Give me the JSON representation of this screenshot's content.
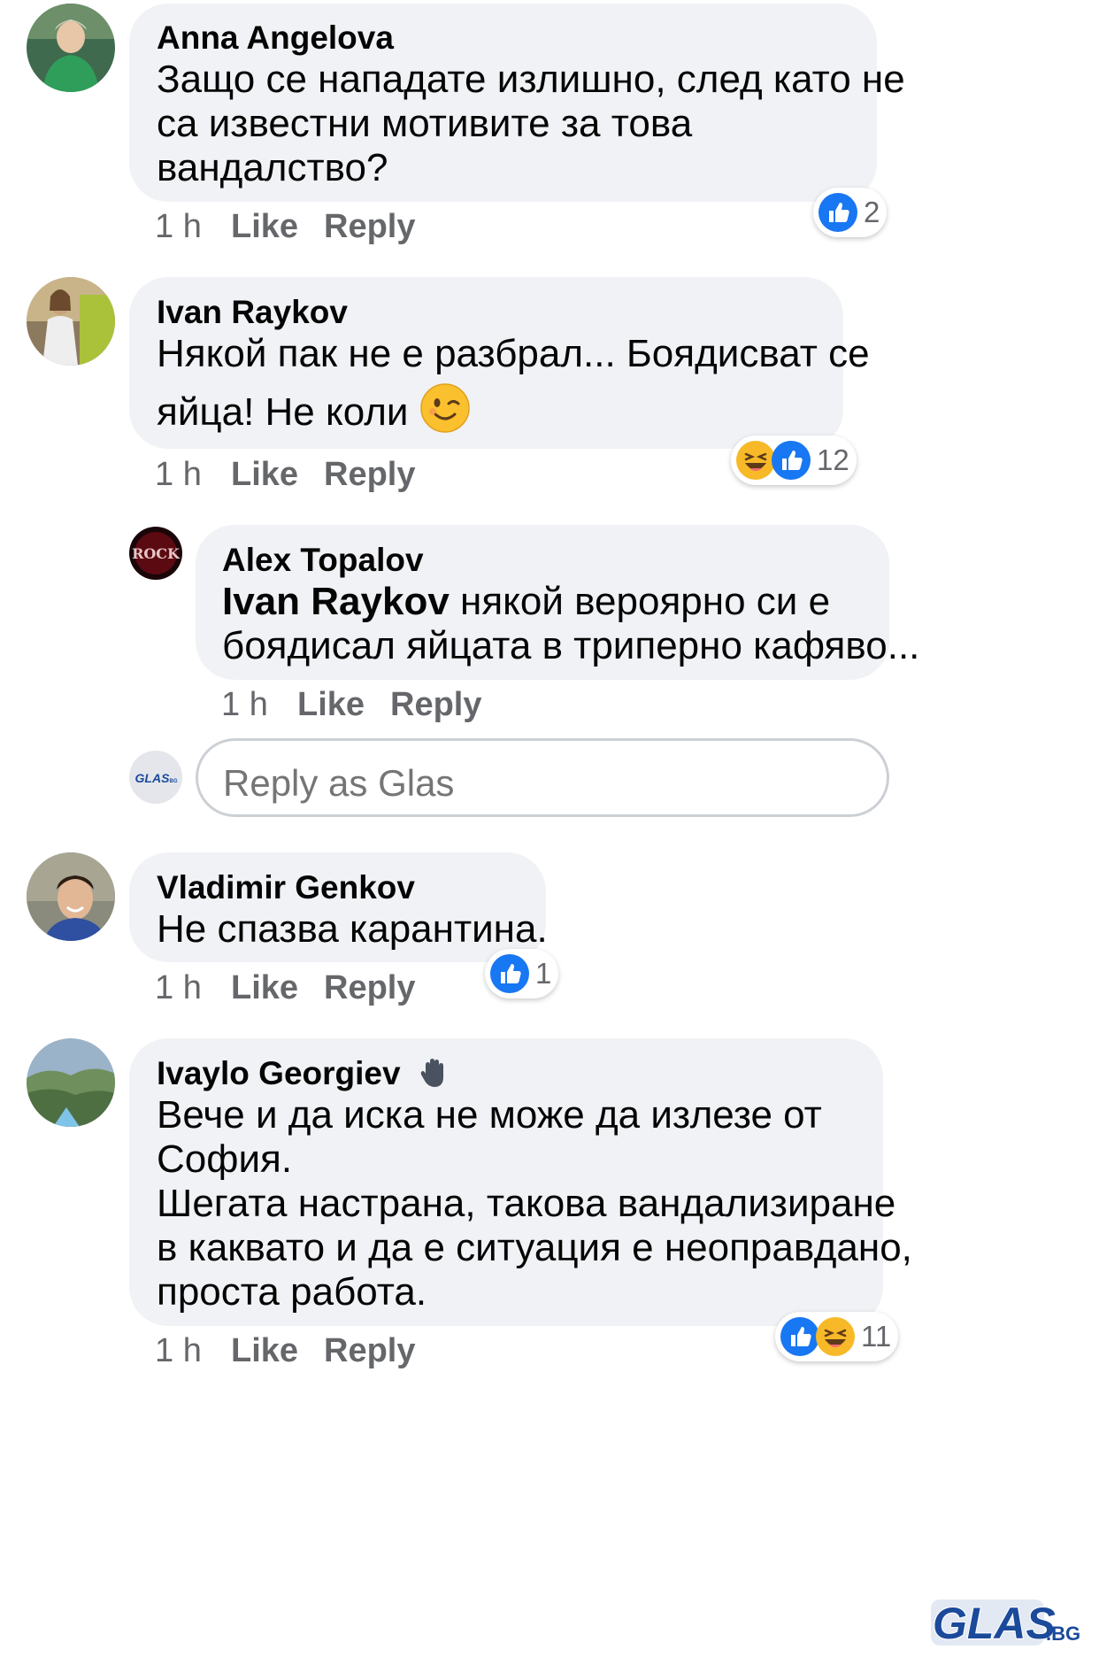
{
  "comments": [
    {
      "author": "Anna Angelova",
      "lines": [
        "Защо се нападате излишно, след като не",
        "са известни мотивите за това",
        "вандалство?"
      ],
      "time": "1 h",
      "like_label": "Like",
      "reply_label": "Reply",
      "reaction_count": "2",
      "reaction_icons": [
        "like-icon"
      ]
    },
    {
      "author": "Ivan Raykov",
      "lines": [
        "Някой пак не е разбрал... Боядисват се",
        "яйца! Не коли"
      ],
      "emoji": "winking-face-emoji",
      "time": "1 h",
      "like_label": "Like",
      "reply_label": "Reply",
      "reaction_count": "12",
      "reaction_icons": [
        "haha-icon",
        "like-icon"
      ]
    },
    {
      "author": "Alex Topalov",
      "mention": "Ivan Raykov",
      "lines": [
        " някой вероярно си е",
        "боядисал яйцата в триперно кафяво..."
      ],
      "time": "1 h",
      "like_label": "Like",
      "reply_label": "Reply"
    },
    {
      "author": "Vladimir Genkov",
      "lines": [
        "Не спазва карантина."
      ],
      "time": "1 h",
      "like_label": "Like",
      "reply_label": "Reply",
      "reaction_count": "1",
      "reaction_icons": [
        "like-icon"
      ]
    },
    {
      "author": "Ivaylo Georgiev",
      "author_icon": "waving-hand-icon",
      "lines": [
        "Вече и да иска не може да излезе от",
        "София.",
        "Шегата настрана, такова вандализиране",
        "в каквато и да е ситуация е неоправдано,",
        "проста работа."
      ],
      "time": "1 h",
      "like_label": "Like",
      "reply_label": "Reply",
      "reaction_count": "11",
      "reaction_icons": [
        "like-icon",
        "haha-icon"
      ]
    }
  ],
  "reply_box": {
    "placeholder": "Reply as Glas",
    "avatar_logo_text": "GLAS",
    "avatar_logo_suffix": "BG"
  },
  "watermark": {
    "text": "GLAS",
    "suffix": ".BG"
  },
  "colors": {
    "bubble": "#f0f2f5",
    "meta_text": "#65676b",
    "like_blue": "#1877f2",
    "haha_yellow": "#f7b928",
    "watermark_blue": "#1b4a9b"
  }
}
